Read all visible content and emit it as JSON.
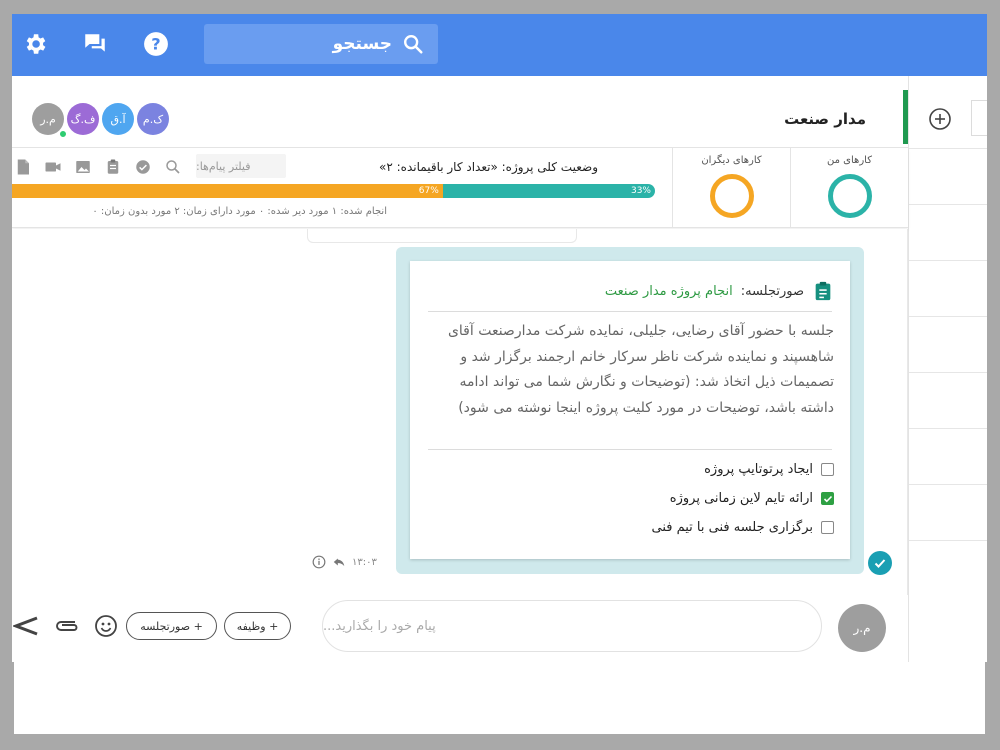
{
  "topbar": {
    "search_label": "جستجو",
    "icons": [
      "gear-icon",
      "chat-icon",
      "help-icon",
      "search-icon"
    ],
    "color": "#4a87ea"
  },
  "header": {
    "project_title": "مدار صنعت",
    "avatars": [
      {
        "initials": "م.ر",
        "color": "#9e9e9e"
      },
      {
        "initials": "ف.گ",
        "color": "#9c6bd6"
      },
      {
        "initials": "آ.ق",
        "color": "#4fa6f0"
      },
      {
        "initials": "ک.م",
        "color": "#7b83e0"
      }
    ]
  },
  "status": {
    "my_tasks_label": "کارهای من",
    "others_tasks_label": "کارهای دیگران",
    "overall_status": "وضعیت کلی پروژه: «تعداد کار باقیمانده: ۲»",
    "filter_placeholder": "فیلتر پیام‌ها:",
    "progress": {
      "done_pct": 33,
      "done_label": "33%",
      "rest_pct": 67,
      "rest_label": "67%",
      "done_color": "#2bb3a8",
      "rest_color": "#f5a623"
    },
    "counts_text": "انجام شده: ۱ مورد    دیر شده: ۰ مورد    دارای زمان: ۲ مورد    بدون زمان: ۰"
  },
  "message": {
    "header_label": "صورتجلسه:",
    "header_title": "انجام پروژه مدار صنعت",
    "body": "جلسه با حضور آقای رضایی، جلیلی، نمایده شرکت مدارصنعت آقای شاهسپند و نماینده شرکت ناظر سرکار خانم ارجمند برگزار شد و تصمیمات ذیل اتخاذ شد: (توضیحات و نگارش شما می تواند ادامه داشته باشد، توضیحات در مورد کلیت پروژه اینجا نوشته می شود)",
    "todos": [
      {
        "label": "ایجاد پرتوتایپ پروژه",
        "checked": false
      },
      {
        "label": "ارائه تایم لاین زمانی پروژه",
        "checked": true
      },
      {
        "label": "برگزاری جلسه فنی با تیم فنی",
        "checked": false
      }
    ],
    "time": "۱۳:۰۳"
  },
  "composer": {
    "placeholder": "پیام خود را بگذارید...",
    "my_initials": "م.ر",
    "task_button": "+ وظیفه",
    "minutes_button": "+ صورتجلسه"
  }
}
